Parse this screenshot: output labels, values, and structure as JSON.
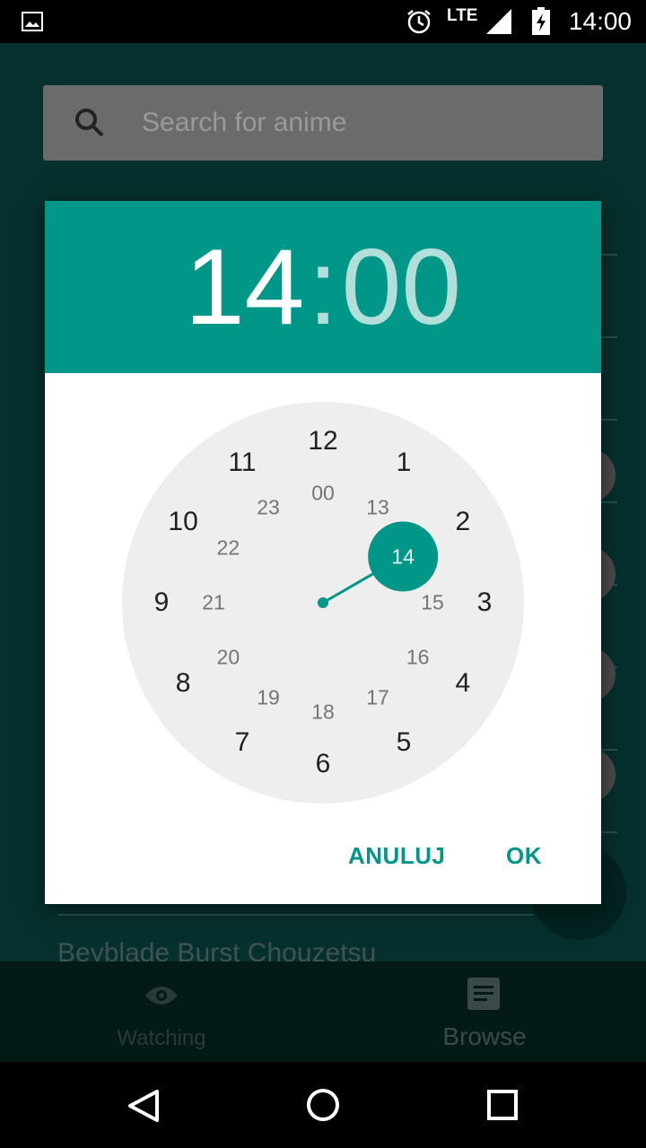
{
  "status_bar": {
    "time": "14:00",
    "network": "LTE"
  },
  "search": {
    "placeholder": "Search for anime"
  },
  "background": {
    "list_title": "Beyblade Burst Chouzetsu"
  },
  "bottom_nav": {
    "watching_label": "Watching",
    "browse_label": "Browse"
  },
  "time_picker": {
    "hours": "14",
    "separator": ":",
    "minutes": "00",
    "selected_hour": 14,
    "outer_numbers": [
      "12",
      "1",
      "2",
      "3",
      "4",
      "5",
      "6",
      "7",
      "8",
      "9",
      "10",
      "11"
    ],
    "inner_numbers": [
      "00",
      "13",
      "14",
      "15",
      "16",
      "17",
      "18",
      "19",
      "20",
      "21",
      "22",
      "23"
    ],
    "cancel_label": "ANULUJ",
    "ok_label": "OK"
  },
  "colors": {
    "accent": "#009688",
    "header_text_active": "#ffffff",
    "header_text_inactive": "#b3dfdb",
    "clock_face": "#eeeeee",
    "app_background": "#06302d"
  },
  "icons": [
    "image-icon",
    "alarm-icon",
    "signal-icon",
    "battery-charging-icon",
    "search-icon",
    "eye-icon",
    "list-icon",
    "back-icon",
    "home-icon",
    "recents-icon"
  ]
}
